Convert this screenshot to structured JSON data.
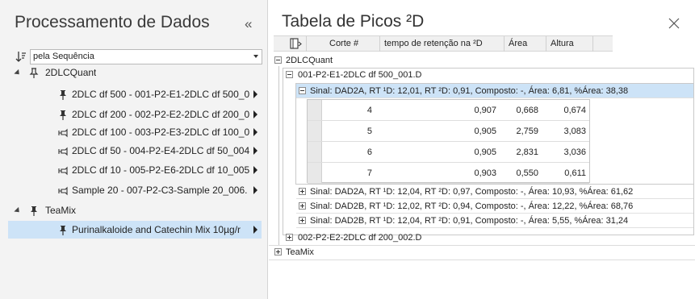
{
  "left_panel": {
    "title": "Processamento de Dados",
    "collapse_glyph": "«",
    "sort": {
      "value": "pela Sequência"
    },
    "tree": [
      {
        "label": "2DLCQuant",
        "level": 0,
        "icon": "pin-outline-icon",
        "expanded": true
      },
      {
        "label": "2DLC df 500 - 001-P2-E1-2DLC df 500_0",
        "level": 1,
        "icon": "pin-filled-icon"
      },
      {
        "label": "2DLC df 200 - 002-P2-E2-2DLC df 200_0",
        "level": 1,
        "icon": "pin-filled-icon"
      },
      {
        "label": "2DLC df 100 - 003-P2-E3-2DLC df 100_0",
        "level": 1,
        "icon": "pin-side-icon"
      },
      {
        "label": "2DLC df 50 - 004-P2-E4-2DLC df 50_004",
        "level": 1,
        "icon": "pin-side-icon"
      },
      {
        "label": "2DLC df 10 - 005-P2-E6-2DLC df 10_005",
        "level": 1,
        "icon": "pin-side-icon"
      },
      {
        "label": "Sample 20 - 007-P2-C3-Sample 20_006.",
        "level": 1,
        "icon": "pin-side-icon"
      },
      {
        "label": "TeaMix",
        "level": 0,
        "icon": "pin-filled-icon",
        "expanded": true
      },
      {
        "label": "Purinalkaloide and Catechin Mix 10µg/r",
        "level": 1,
        "icon": "pin-filled-icon",
        "selected": true
      }
    ]
  },
  "right_panel": {
    "title": "Tabela de Picos ²D",
    "columns": [
      "Corte #",
      "tempo de retenção na ²D",
      "Área",
      "Altura"
    ],
    "groups": {
      "g1": "2DLCQuant",
      "g1_sub1": "001-P2-E1-2DLC df 500_001.D",
      "sig1": "Sinal: DAD2A, RT ¹D: 12,01, RT ²D: 0,91, Composto: -, Área: 6,81, %Área: 38,38",
      "sig2": "Sinal: DAD2A, RT ¹D: 12,04, RT ²D: 0,97, Composto: -, Área: 10,93, %Área: 61,62",
      "sig3": "Sinal: DAD2B, RT ¹D: 12,02, RT ²D: 0,94, Composto: -, Área: 12,22, %Área: 68,76",
      "sig4": "Sinal: DAD2B, RT ¹D: 12,04, RT ²D: 0,91, Composto: -, Área: 5,55, %Área: 31,24",
      "g1_sub2": "002-P2-E2-2DLC df 200_002.D",
      "g2": "TeaMix"
    },
    "rows": [
      {
        "corte": "4",
        "rt": "0,907",
        "area": "0,668",
        "altura": "0,674"
      },
      {
        "corte": "5",
        "rt": "0,905",
        "area": "2,759",
        "altura": "3,083"
      },
      {
        "corte": "6",
        "rt": "0,905",
        "area": "2,831",
        "altura": "3,036"
      },
      {
        "corte": "7",
        "rt": "0,903",
        "area": "0,550",
        "altura": "0,611"
      }
    ]
  }
}
